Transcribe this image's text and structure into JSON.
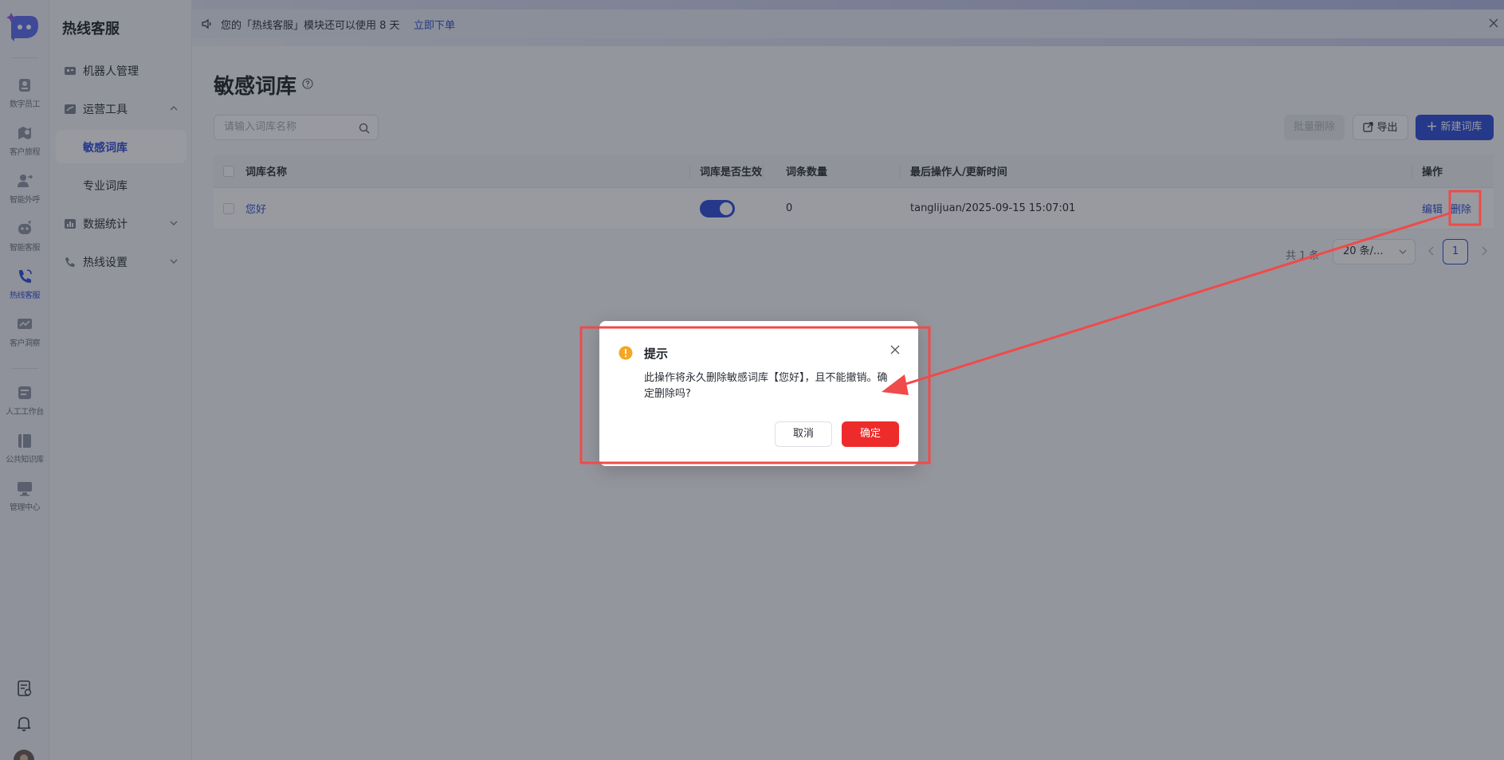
{
  "colors": {
    "accent": "#2c4bd8",
    "danger": "#ee2b2b",
    "warning": "#f5a623",
    "annotation": "#f04a4a"
  },
  "rail": {
    "items": [
      {
        "label": "数字员工",
        "icon": "digital-employee-icon"
      },
      {
        "label": "客户旅程",
        "icon": "customer-journey-icon"
      },
      {
        "label": "智能外呼",
        "icon": "outbound-call-icon"
      },
      {
        "label": "智能客服",
        "icon": "smart-service-icon"
      },
      {
        "label": "热线客服",
        "icon": "hotline-icon",
        "active": true
      },
      {
        "label": "客户洞察",
        "icon": "customer-insight-icon"
      },
      {
        "label": "人工工作台",
        "icon": "workbench-icon"
      },
      {
        "label": "公共知识库",
        "icon": "knowledge-base-icon"
      },
      {
        "label": "管理中心",
        "icon": "admin-center-icon"
      }
    ],
    "bottom_icons": [
      "task-list-icon",
      "bell-icon",
      "avatar"
    ]
  },
  "subnav": {
    "title": "热线客服",
    "items": [
      {
        "label": "机器人管理",
        "icon": "robot-icon"
      },
      {
        "label": "运营工具",
        "icon": "tools-icon",
        "expanded": true
      },
      {
        "label": "敏感词库",
        "sub": true,
        "active": true
      },
      {
        "label": "专业词库",
        "sub": true
      },
      {
        "label": "数据统计",
        "icon": "chart-icon",
        "expanded": false
      },
      {
        "label": "热线设置",
        "icon": "phone-settings-icon",
        "expanded": false
      }
    ]
  },
  "notice": {
    "text": "您的「热线客服」模块还可以使用 8 天",
    "link": "立即下单"
  },
  "page": {
    "title": "敏感词库",
    "search_placeholder": "请输入词库名称",
    "batch_delete": "批量删除",
    "export": "导出",
    "new_lexicon": "新建词库"
  },
  "table": {
    "headers": [
      "词库名称",
      "词库是否生效",
      "词条数量",
      "最后操作人/更新时间",
      "操作"
    ],
    "rows": [
      {
        "name": "您好",
        "enabled": true,
        "count": "0",
        "updated": "tanglijuan/2025-09-15 15:07:01",
        "edit": "编辑",
        "delete": "删除"
      }
    ]
  },
  "pager": {
    "total": "共 1 条",
    "size": "20 条/...",
    "page": "1"
  },
  "dialog": {
    "title": "提示",
    "message": "此操作将永久删除敏感词库【您好】，且不能撤销。确定删除吗?",
    "cancel": "取消",
    "confirm": "确定"
  }
}
